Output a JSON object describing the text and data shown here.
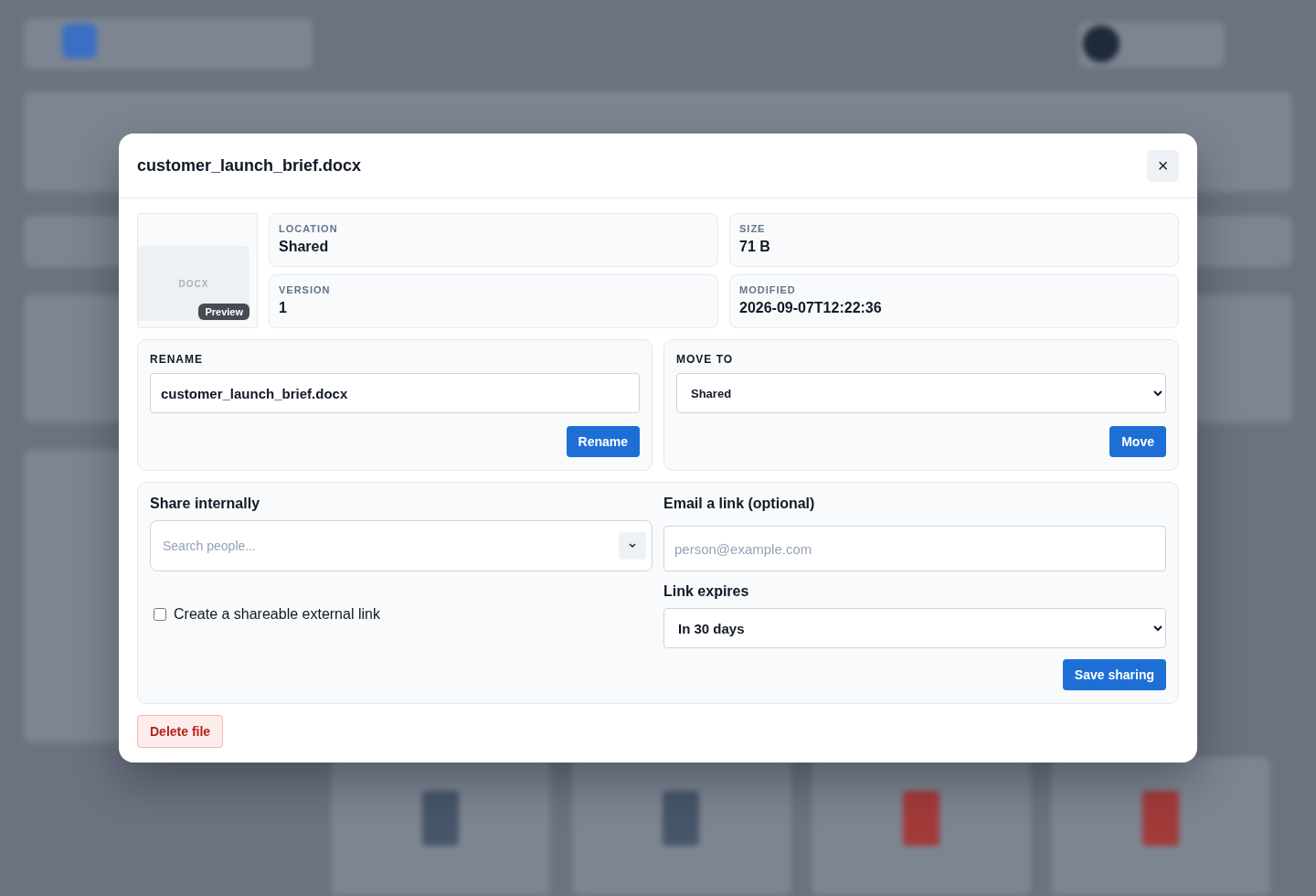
{
  "dialog": {
    "title": "customer_launch_brief.docx",
    "close": "×"
  },
  "preview": {
    "file_type": "DOCX",
    "badge": "Preview"
  },
  "details": [
    {
      "label": "LOCATION",
      "value": "Shared"
    },
    {
      "label": "SIZE",
      "value": "71 B"
    },
    {
      "label": "VERSION",
      "value": "1"
    },
    {
      "label": "MODIFIED",
      "value": "2026-09-07T12:22:36"
    }
  ],
  "rename": {
    "label": "RENAME",
    "value": "customer_launch_brief.docx",
    "button": "Rename"
  },
  "move": {
    "label": "MOVE TO",
    "value": "Shared",
    "button": "Move"
  },
  "share": {
    "internal_label": "Share internally",
    "people_placeholder": "Search people...",
    "external_link": {
      "label": "Create a shareable external link",
      "checked": false
    },
    "email_label": "Email a link (optional)",
    "email_placeholder": "person@example.com",
    "expires_label": "Link expires",
    "expires_value": "In 30 days",
    "button": "Save sharing"
  },
  "delete_button": "Delete file"
}
